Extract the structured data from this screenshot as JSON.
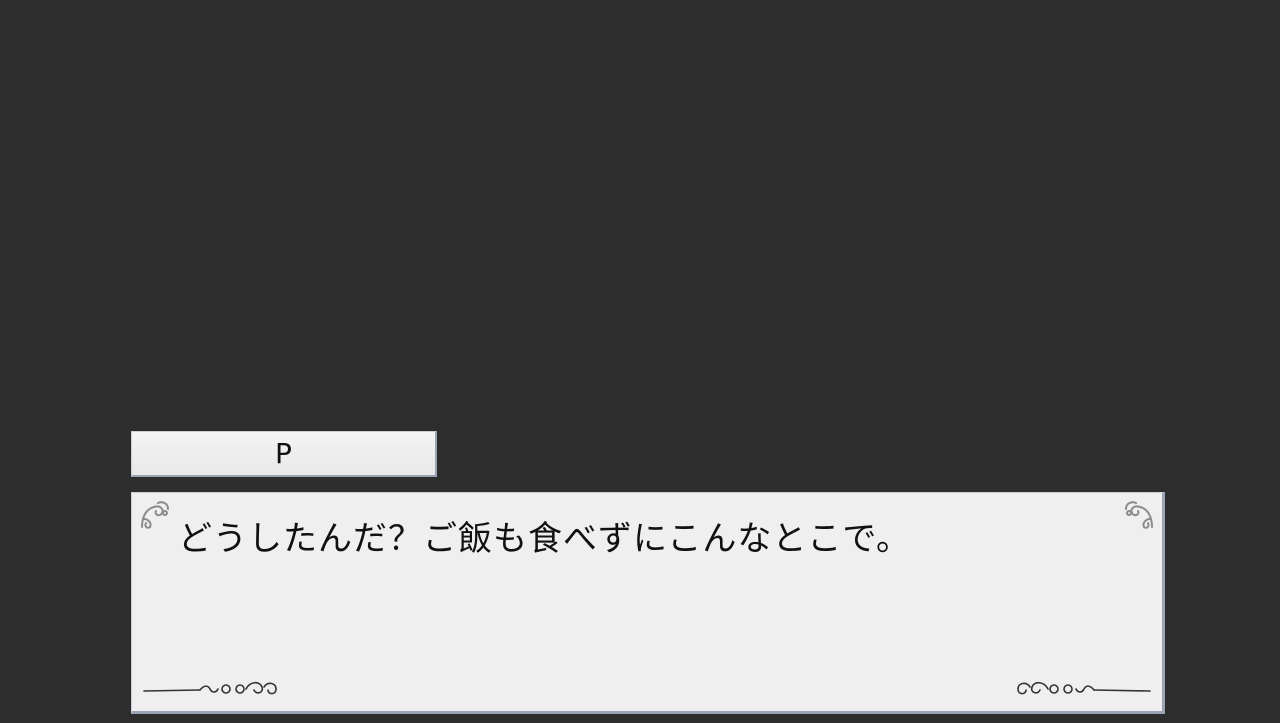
{
  "dialogue": {
    "speaker": "P",
    "message": "どうしたんだ？ご飯も食べずにこんなとこで。"
  },
  "icons": {
    "corner_top_left": "flourish-icon",
    "corner_top_right": "flourish-icon",
    "corner_bottom_left": "scroll-flourish-icon",
    "corner_bottom_right": "scroll-flourish-icon"
  },
  "colors": {
    "background": "#2d2d2d",
    "box_fill": "#efefef",
    "box_border": "#9aa4b2",
    "text": "#111111"
  }
}
